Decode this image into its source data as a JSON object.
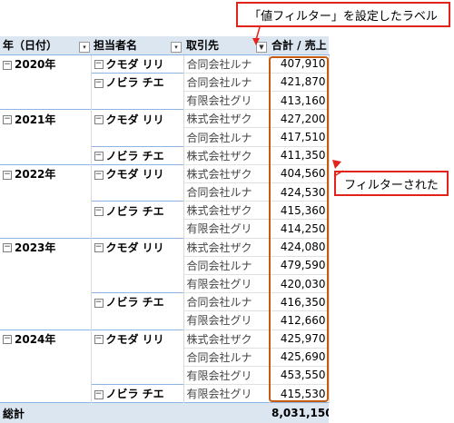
{
  "headers": {
    "year": "年（日付）",
    "person": "担当者名",
    "client": "取引先",
    "total": "合計 / 売上"
  },
  "rows": [
    {
      "year": "2020年",
      "person": "クモダ リリ",
      "client": "合同会社ルナ",
      "amount": "407,910"
    },
    {
      "year": "",
      "person": "ノビラ チエ",
      "client": "合同会社ルナ",
      "amount": "421,870"
    },
    {
      "year": "",
      "person": "",
      "client": "有限会社グリ",
      "amount": "413,160"
    },
    {
      "year": "2021年",
      "person": "クモダ リリ",
      "client": "株式会社ザク",
      "amount": "427,200"
    },
    {
      "year": "",
      "person": "",
      "client": "合同会社ルナ",
      "amount": "417,510"
    },
    {
      "year": "",
      "person": "ノビラ チエ",
      "client": "株式会社ザク",
      "amount": "411,350"
    },
    {
      "year": "2022年",
      "person": "クモダ リリ",
      "client": "株式会社ザク",
      "amount": "404,560"
    },
    {
      "year": "",
      "person": "",
      "client": "合同会社ルナ",
      "amount": "424,530"
    },
    {
      "year": "",
      "person": "ノビラ チエ",
      "client": "株式会社ザク",
      "amount": "415,360"
    },
    {
      "year": "",
      "person": "",
      "client": "有限会社グリ",
      "amount": "414,250"
    },
    {
      "year": "2023年",
      "person": "クモダ リリ",
      "client": "株式会社ザク",
      "amount": "424,080"
    },
    {
      "year": "",
      "person": "",
      "client": "合同会社ルナ",
      "amount": "479,590"
    },
    {
      "year": "",
      "person": "",
      "client": "有限会社グリ",
      "amount": "420,030"
    },
    {
      "year": "",
      "person": "ノビラ チエ",
      "client": "合同会社ルナ",
      "amount": "416,350"
    },
    {
      "year": "",
      "person": "",
      "client": "有限会社グリ",
      "amount": "412,660"
    },
    {
      "year": "2024年",
      "person": "クモダ リリ",
      "client": "株式会社ザク",
      "amount": "425,970"
    },
    {
      "year": "",
      "person": "",
      "client": "合同会社ルナ",
      "amount": "425,690"
    },
    {
      "year": "",
      "person": "",
      "client": "有限会社グリ",
      "amount": "453,550"
    },
    {
      "year": "",
      "person": "ノビラ チエ",
      "client": "有限会社グリ",
      "amount": "415,530"
    }
  ],
  "grand_total": {
    "label": "総計",
    "amount": "8,031,150"
  },
  "annotations": {
    "label_filter": "「値フィルター」を設定したラベル",
    "filtered": "フィルターされた"
  },
  "colors": {
    "header_bg": "#dce6f1",
    "callout_border": "#e2231a",
    "highlight_border": "#c55a11"
  }
}
